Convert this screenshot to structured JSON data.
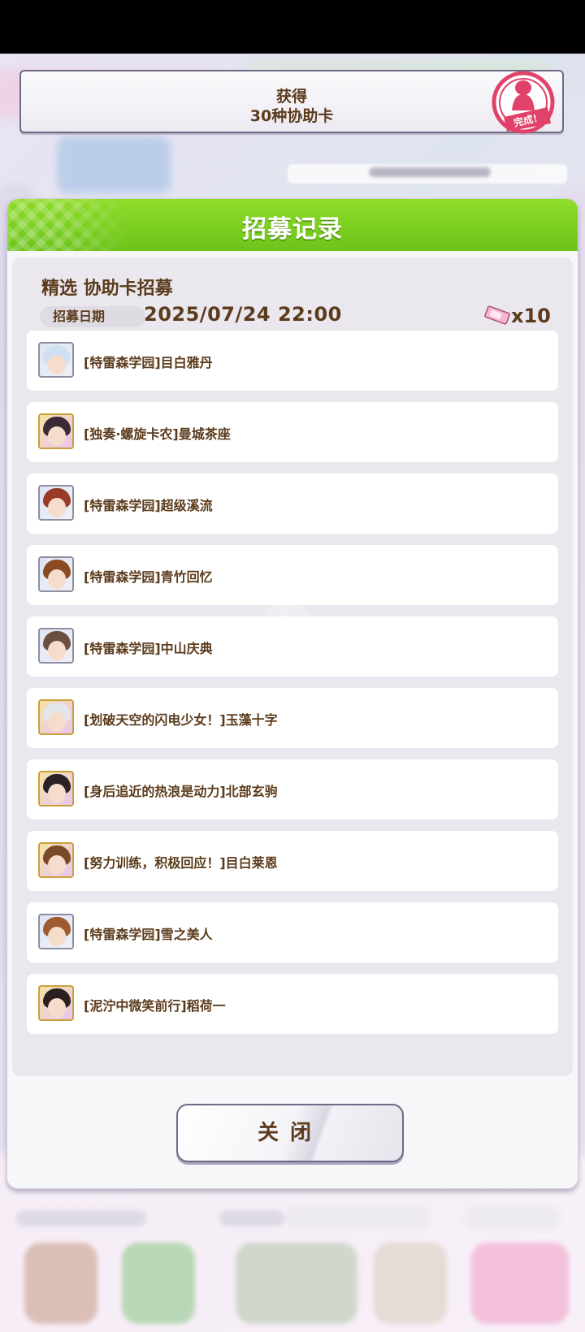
{
  "achievement": {
    "line1": "获得",
    "line2": "30种协助卡",
    "stamp_text": "完成！"
  },
  "modal": {
    "title": "招募记录",
    "section_title": "精选 协助卡招募",
    "date_label": "招募日期",
    "date_value": "2025/07/24 22:00",
    "ticket_count": "x10",
    "items": [
      {
        "label": "[特雷森学园]目白雅丹",
        "rarity": "SR",
        "hair": "#cfe0f2"
      },
      {
        "label": "[独奏·螺旋卡农]曼城茶座",
        "rarity": "SSR",
        "hair": "#3a2a36"
      },
      {
        "label": "[特雷森学园]超级溪流",
        "rarity": "SR",
        "hair": "#9a3a2a"
      },
      {
        "label": "[特雷森学园]青竹回忆",
        "rarity": "SR",
        "hair": "#8a4a22"
      },
      {
        "label": "[特雷森学园]中山庆典",
        "rarity": "SR",
        "hair": "#6b5040"
      },
      {
        "label": "[划破天空的闪电少女！]玉藻十字",
        "rarity": "SSR",
        "hair": "#e4e6ee"
      },
      {
        "label": "[身后追近的热浪是动力]北部玄驹",
        "rarity": "SSR",
        "hair": "#2a2226"
      },
      {
        "label": "[努力训练，积极回应！]目白莱恩",
        "rarity": "SSR",
        "hair": "#7a4a28"
      },
      {
        "label": "[特雷森学园]雪之美人",
        "rarity": "SR",
        "hair": "#a05a30"
      },
      {
        "label": "[泥泞中微笑前行]稻荷一",
        "rarity": "SSR",
        "hair": "#2a2020"
      }
    ],
    "close_label": "关闭"
  },
  "colors": {
    "header_green": "#7ccf22",
    "text_brown": "#5b3b1c",
    "stamp_red": "#e0426a"
  }
}
